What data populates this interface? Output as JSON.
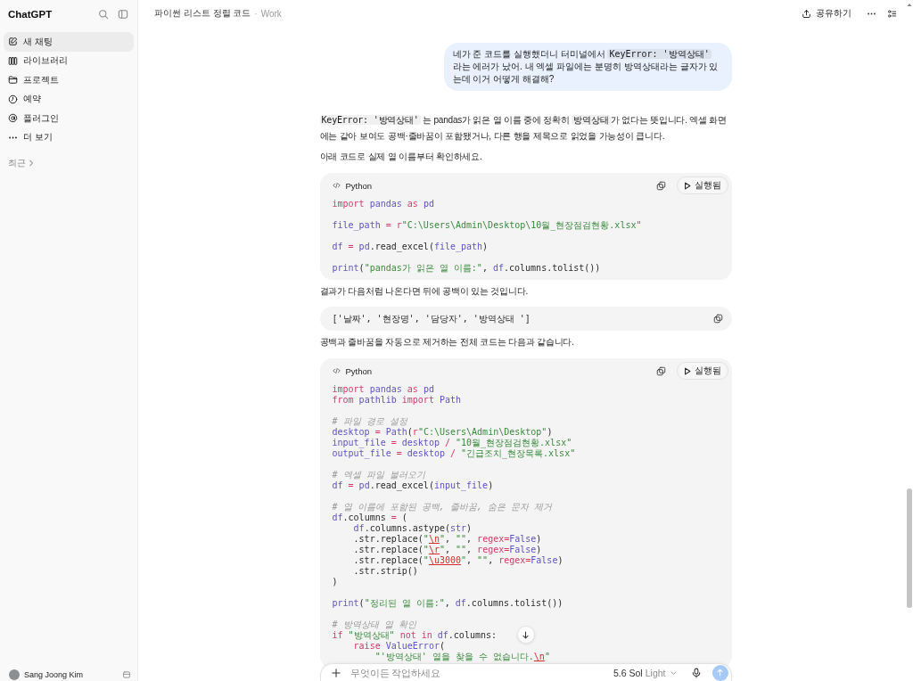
{
  "sidebar": {
    "logo": "ChatGPT",
    "items": [
      {
        "label": "새 채팅",
        "selected": true
      },
      {
        "label": "라이브러리",
        "selected": false
      },
      {
        "label": "프로젝트",
        "selected": false
      },
      {
        "label": "예약",
        "selected": false
      },
      {
        "label": "플러그인",
        "selected": false
      },
      {
        "label": "더 보기",
        "selected": false
      }
    ],
    "section": "최근",
    "user": "Sang Joong Kim"
  },
  "header": {
    "title": "파이썬 리스트 정렬 코드",
    "separator": "·",
    "project": "Work",
    "share": "공유하기"
  },
  "user_message": {
    "segments": [
      {
        "kind": "text",
        "text": "네가 준 코드를 실행했더니 터미널에서 "
      },
      {
        "kind": "code",
        "text": "KeyError: '방역상태'"
      },
      {
        "kind": "text",
        "text": " 라는 에러가 났어. 내 엑셀 파일에는 분명히 방역상태라는 글자가 있는데 이거 어떻게 해결해?"
      }
    ]
  },
  "reply": {
    "blocks": [
      {
        "kind": "paragraph",
        "segments": [
          {
            "kind": "code",
            "text": "KeyError: '방역상태'"
          },
          {
            "kind": "text",
            "text": " 는 pandas가 읽은 열 이름 중에 정확히 "
          },
          {
            "kind": "code",
            "text": "방역상태"
          },
          {
            "kind": "text",
            "text": "가 없다는 뜻입니다. 엑셀 화면에는 같아 보여도 공백·줄바꿈이 포함됐거나, 다른 행을 제목으로 읽었을 가능성이 큽니다."
          }
        ]
      },
      {
        "kind": "paragraph",
        "segments": [
          {
            "kind": "text",
            "text": "아래 코드로 실제 열 이름부터 확인하세요."
          }
        ]
      },
      {
        "kind": "code",
        "language": "Python",
        "run_label": "실행됨",
        "lines": [
          {
            "kind": "code",
            "tokens": [
              {
                "kind": "kw",
                "text": "import "
              },
              {
                "kind": "name",
                "text": "pandas "
              },
              {
                "kind": "kw",
                "text": "as "
              },
              {
                "kind": "name",
                "text": "pd"
              }
            ]
          },
          {
            "kind": "blank"
          },
          {
            "kind": "code",
            "tokens": [
              {
                "kind": "name",
                "text": "file_path "
              },
              {
                "kind": "kw",
                "text": "= r"
              },
              {
                "kind": "str",
                "text": "\"C:\\Users\\Admin\\Desktop\\10월_현장점검현황.xlsx\""
              }
            ]
          },
          {
            "kind": "blank"
          },
          {
            "kind": "code",
            "tokens": [
              {
                "kind": "name",
                "text": "df "
              },
              {
                "kind": "kw",
                "text": "= "
              },
              {
                "kind": "name",
                "text": "pd"
              },
              {
                "kind": "plain",
                "text": ".read_excel("
              },
              {
                "kind": "name",
                "text": "file_path"
              },
              {
                "kind": "plain",
                "text": ")"
              }
            ]
          },
          {
            "kind": "blank"
          },
          {
            "kind": "code",
            "tokens": [
              {
                "kind": "name",
                "text": "print"
              },
              {
                "kind": "plain",
                "text": "("
              },
              {
                "kind": "str",
                "text": "\"pandas가 읽은 열 이름:\""
              },
              {
                "kind": "plain",
                "text": ", "
              },
              {
                "kind": "name",
                "text": "df"
              },
              {
                "kind": "plain",
                "text": ".columns.tolist())"
              }
            ]
          }
        ]
      },
      {
        "kind": "paragraph",
        "segments": [
          {
            "kind": "text",
            "text": "결과가 다음처럼 나온다면 뒤에 공백이 있는 것입니다."
          }
        ]
      },
      {
        "kind": "code",
        "lines": [
          {
            "kind": "code",
            "tokens": [
              {
                "kind": "plain",
                "text": "['날짜', '현장명', '담당자', '방역상태 ']"
              }
            ]
          }
        ]
      },
      {
        "kind": "paragraph",
        "segments": [
          {
            "kind": "text",
            "text": "공백과 줄바꿈을 자동으로 제거하는 전체 코드는 다음과 같습니다."
          }
        ]
      },
      {
        "kind": "code",
        "language": "Python",
        "run_label": "실행됨",
        "lines": [
          {
            "kind": "code",
            "tokens": [
              {
                "kind": "kw",
                "text": "import "
              },
              {
                "kind": "name",
                "text": "pandas "
              },
              {
                "kind": "kw",
                "text": "as "
              },
              {
                "kind": "name",
                "text": "pd"
              }
            ]
          },
          {
            "kind": "code",
            "tokens": [
              {
                "kind": "kw",
                "text": "from "
              },
              {
                "kind": "name",
                "text": "pathlib "
              },
              {
                "kind": "kw",
                "text": "import "
              },
              {
                "kind": "name",
                "text": "Path"
              }
            ]
          },
          {
            "kind": "blank"
          },
          {
            "kind": "code",
            "tokens": [
              {
                "kind": "cm",
                "text": "# 파일 경로 설정"
              }
            ]
          },
          {
            "kind": "code",
            "tokens": [
              {
                "kind": "name",
                "text": "desktop "
              },
              {
                "kind": "kw",
                "text": "= "
              },
              {
                "kind": "name",
                "text": "Path"
              },
              {
                "kind": "plain",
                "text": "("
              },
              {
                "kind": "kw",
                "text": "r"
              },
              {
                "kind": "str",
                "text": "\"C:\\Users\\Admin\\Desktop\""
              },
              {
                "kind": "plain",
                "text": ")"
              }
            ]
          },
          {
            "kind": "code",
            "tokens": [
              {
                "kind": "name",
                "text": "input_file "
              },
              {
                "kind": "kw",
                "text": "= "
              },
              {
                "kind": "name",
                "text": "desktop "
              },
              {
                "kind": "kw",
                "text": "/ "
              },
              {
                "kind": "str",
                "text": "\"10월_현장점검현황.xlsx\""
              }
            ]
          },
          {
            "kind": "code",
            "tokens": [
              {
                "kind": "name",
                "text": "output_file "
              },
              {
                "kind": "kw",
                "text": "= "
              },
              {
                "kind": "name",
                "text": "desktop "
              },
              {
                "kind": "kw",
                "text": "/ "
              },
              {
                "kind": "str",
                "text": "\"긴급조치_현장목록.xlsx\""
              }
            ]
          },
          {
            "kind": "blank"
          },
          {
            "kind": "code",
            "tokens": [
              {
                "kind": "cm",
                "text": "# 엑셀 파일 불러오기"
              }
            ]
          },
          {
            "kind": "code",
            "tokens": [
              {
                "kind": "name",
                "text": "df "
              },
              {
                "kind": "kw",
                "text": "= "
              },
              {
                "kind": "name",
                "text": "pd"
              },
              {
                "kind": "plain",
                "text": ".read_excel("
              },
              {
                "kind": "name",
                "text": "input_file"
              },
              {
                "kind": "plain",
                "text": ")"
              }
            ]
          },
          {
            "kind": "blank"
          },
          {
            "kind": "code",
            "tokens": [
              {
                "kind": "cm",
                "text": "# 열 이름에 포함된 공백, 줄바꿈, 숨은 문자 제거"
              }
            ]
          },
          {
            "kind": "code",
            "tokens": [
              {
                "kind": "name",
                "text": "df"
              },
              {
                "kind": "plain",
                "text": ".columns "
              },
              {
                "kind": "kw",
                "text": "= "
              },
              {
                "kind": "plain",
                "text": "("
              }
            ]
          },
          {
            "kind": "code",
            "tokens": [
              {
                "kind": "name",
                "text": "    df"
              },
              {
                "kind": "plain",
                "text": ".columns.astype("
              },
              {
                "kind": "name",
                "text": "str"
              },
              {
                "kind": "plain",
                "text": ")"
              }
            ]
          },
          {
            "kind": "code",
            "tokens": [
              {
                "kind": "plain",
                "text": "    .str.replace("
              },
              {
                "kind": "str",
                "text": "\""
              },
              {
                "kind": "esc",
                "text": "\\n"
              },
              {
                "kind": "str",
                "text": "\""
              },
              {
                "kind": "plain",
                "text": ", "
              },
              {
                "kind": "str",
                "text": "\"\""
              },
              {
                "kind": "plain",
                "text": ", "
              },
              {
                "kind": "kw",
                "text": "regex="
              },
              {
                "kind": "name",
                "text": "False"
              },
              {
                "kind": "plain",
                "text": ")"
              }
            ]
          },
          {
            "kind": "code",
            "tokens": [
              {
                "kind": "plain",
                "text": "    .str.replace("
              },
              {
                "kind": "str",
                "text": "\""
              },
              {
                "kind": "esc",
                "text": "\\r"
              },
              {
                "kind": "str",
                "text": "\""
              },
              {
                "kind": "plain",
                "text": ", "
              },
              {
                "kind": "str",
                "text": "\"\""
              },
              {
                "kind": "plain",
                "text": ", "
              },
              {
                "kind": "kw",
                "text": "regex="
              },
              {
                "kind": "name",
                "text": "False"
              },
              {
                "kind": "plain",
                "text": ")"
              }
            ]
          },
          {
            "kind": "code",
            "tokens": [
              {
                "kind": "plain",
                "text": "    .str.replace("
              },
              {
                "kind": "str",
                "text": "\""
              },
              {
                "kind": "esc",
                "text": "\\u3000"
              },
              {
                "kind": "str",
                "text": "\""
              },
              {
                "kind": "plain",
                "text": ", "
              },
              {
                "kind": "str",
                "text": "\"\""
              },
              {
                "kind": "plain",
                "text": ", "
              },
              {
                "kind": "kw",
                "text": "regex="
              },
              {
                "kind": "name",
                "text": "False"
              },
              {
                "kind": "plain",
                "text": ")"
              }
            ]
          },
          {
            "kind": "code",
            "tokens": [
              {
                "kind": "plain",
                "text": "    .str.strip()"
              }
            ]
          },
          {
            "kind": "code",
            "tokens": [
              {
                "kind": "plain",
                "text": ")"
              }
            ]
          },
          {
            "kind": "blank"
          },
          {
            "kind": "code",
            "tokens": [
              {
                "kind": "name",
                "text": "print"
              },
              {
                "kind": "plain",
                "text": "("
              },
              {
                "kind": "str",
                "text": "\"정리된 열 이름:\""
              },
              {
                "kind": "plain",
                "text": ", "
              },
              {
                "kind": "name",
                "text": "df"
              },
              {
                "kind": "plain",
                "text": ".columns.tolist())"
              }
            ]
          },
          {
            "kind": "blank"
          },
          {
            "kind": "code",
            "tokens": [
              {
                "kind": "cm",
                "text": "# 방역상태 열 확인"
              }
            ]
          },
          {
            "kind": "code",
            "tokens": [
              {
                "kind": "kw",
                "text": "if "
              },
              {
                "kind": "str",
                "text": "\"방역상태\" "
              },
              {
                "kind": "kw",
                "text": "not in "
              },
              {
                "kind": "name",
                "text": "df"
              },
              {
                "kind": "plain",
                "text": ".columns:"
              }
            ]
          },
          {
            "kind": "code",
            "tokens": [
              {
                "kind": "kw",
                "text": "    raise "
              },
              {
                "kind": "name",
                "text": "ValueError"
              },
              {
                "kind": "plain",
                "text": "("
              }
            ]
          },
          {
            "kind": "code",
            "tokens": [
              {
                "kind": "str",
                "text": "        \"'방역상태' 열을 찾을 수 없습니다."
              },
              {
                "kind": "esc",
                "text": "\\n"
              },
              {
                "kind": "str",
                "text": "\""
              }
            ]
          }
        ]
      }
    ]
  },
  "composer": {
    "placeholder": "무엇이든 작업하세요",
    "model": "5.6 Sol",
    "mode": "Light",
    "send_disabled": true
  }
}
